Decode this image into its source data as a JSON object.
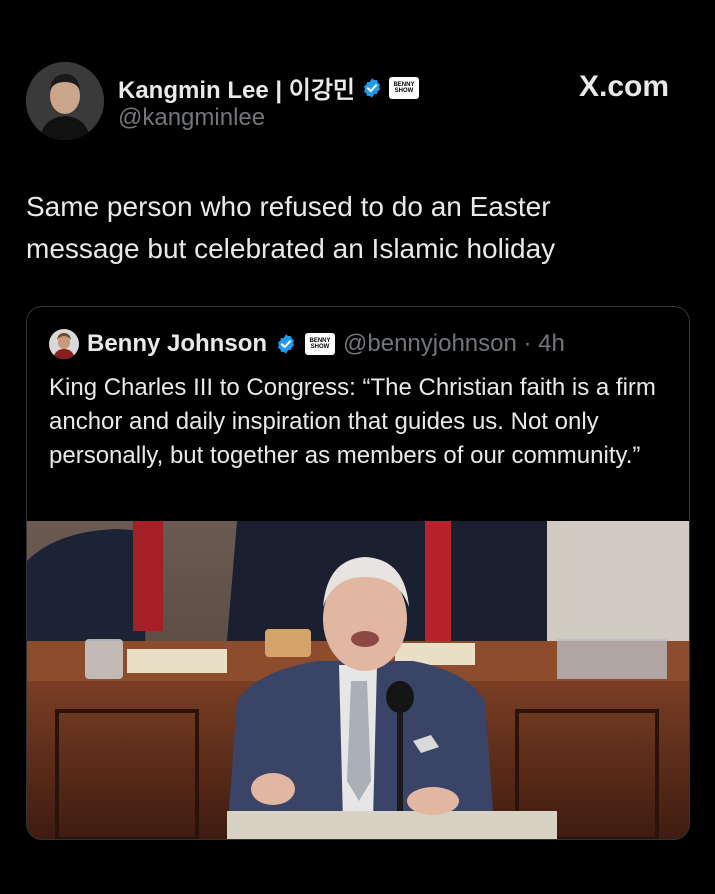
{
  "header": {
    "display_name": "Kangmin Lee | 이강민",
    "handle": "@kangminlee",
    "site": "X.com",
    "badge_text": "BENNY SHOW"
  },
  "tweet": {
    "text": "Same person who refused to do an Easter message but celebrated an Islamic holiday"
  },
  "quote": {
    "display_name": "Benny Johnson",
    "handle_time": "@bennyjohnson · 4h",
    "text": "King Charles III to Congress: “The Christian faith is a firm anchor and daily inspiration that guides us. Not only personally, but together as members of our community.”"
  },
  "colors": {
    "background": "#000000",
    "text": "#e7e9ea",
    "muted": "#71767b",
    "verified_blue": "#1d9bf0",
    "border": "#2f3336"
  },
  "icons": [
    "verified-badge-icon",
    "affiliate-badge-icon"
  ]
}
